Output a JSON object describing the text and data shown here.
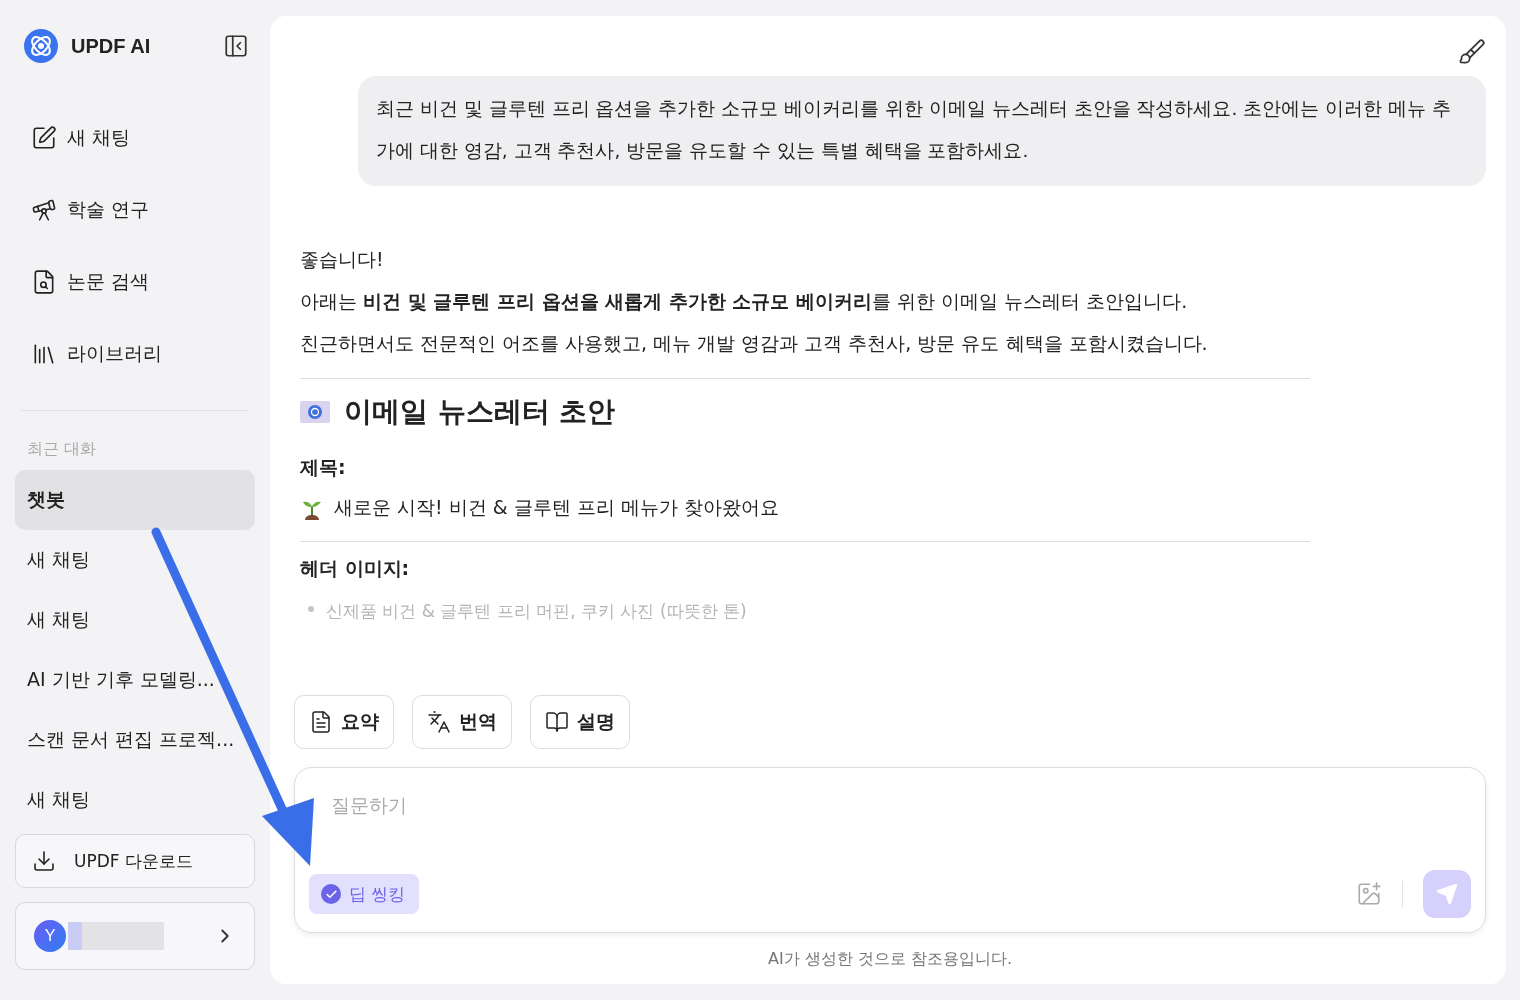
{
  "sidebar": {
    "brand": "UPDF AI",
    "nav": [
      {
        "kind": "edit",
        "label": "새 채팅"
      },
      {
        "kind": "telescope",
        "label": "학술 연구"
      },
      {
        "kind": "search",
        "label": "논문 검색"
      },
      {
        "kind": "library",
        "label": "라이브러리"
      }
    ],
    "recent_heading": "최근 대화",
    "recent": [
      {
        "label": "챗봇",
        "selected": true
      },
      {
        "label": "새 채팅",
        "selected": false
      },
      {
        "label": "새 채팅",
        "selected": false
      },
      {
        "label": "AI 기반 기후 모델링...",
        "selected": false
      },
      {
        "label": "스캔 문서 편집 프로젝...",
        "selected": false
      },
      {
        "label": "새 채팅",
        "selected": false
      }
    ],
    "download_button": "UPDF 다운로드",
    "account": {
      "initial": "Y"
    }
  },
  "chat": {
    "user_message": "최근 비건 및 글루텐 프리 옵션을 추가한 소규모 베이커리를 위한 이메일 뉴스레터 초안을 작성하세요. 초안에는 이러한 메뉴 추가에 대한 영감, 고객 추천사, 방문을 유도할 수 있는 특별 혜택을 포함하세요.",
    "intro": [
      "좋습니다!",
      "아래는 **비건 및 글루텐 프리 옵션을 새롭게 추가한 소규모 베이커리**를 위한 이메일 뉴스레터 초안입니다.",
      "친근하면서도 전문적인 어조를 사용했고, 메뉴 개발 영감과 고객 추천사, 방문 유도 혜택을 포함시켰습니다."
    ],
    "heading": "이메일 뉴스레터 초안",
    "subject_label": "제목:",
    "subject": "새로운 시작! 비건 & 글루텐 프리 메뉴가 찾아왔어요",
    "header_image_label": "헤더 이미지:",
    "faded_bullet": "신제품 비건 & 글루텐 프리 머핀, 쿠키 사진 (따뜻한 톤)"
  },
  "actions": [
    {
      "kind": "summary",
      "label": "요약"
    },
    {
      "kind": "translate",
      "label": "번역"
    },
    {
      "kind": "book",
      "label": "설명"
    }
  ],
  "composer": {
    "placeholder": "질문하기",
    "deep_thinking": {
      "label": "딥 씽킹",
      "on": true
    }
  },
  "disclaimer": "AI가 생성한 것으로 참조용입니다."
}
